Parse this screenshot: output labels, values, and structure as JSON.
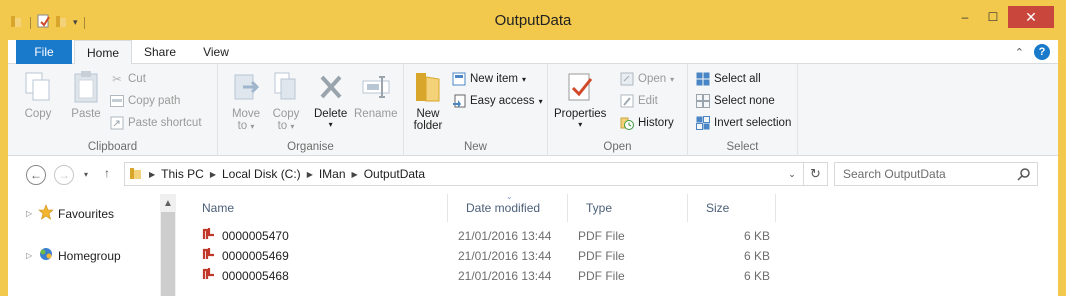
{
  "window": {
    "title": "OutputData",
    "controls": {
      "minimize": "–",
      "maximize": "☐",
      "close": "✕"
    }
  },
  "ribbon": {
    "tabs": [
      "File",
      "Home",
      "Share",
      "View"
    ],
    "active_tab": "Home",
    "groups": {
      "clipboard": {
        "label": "Clipboard",
        "copy": "Copy",
        "paste": "Paste",
        "cut": "Cut",
        "copy_path": "Copy path",
        "paste_shortcut": "Paste shortcut"
      },
      "organise": {
        "label": "Organise",
        "move_to": "Move",
        "move_to_2": "to",
        "copy_to": "Copy",
        "copy_to_2": "to",
        "delete": "Delete",
        "rename": "Rename"
      },
      "new": {
        "label": "New",
        "new_folder": "New",
        "new_folder_2": "folder",
        "new_item": "New item",
        "easy_access": "Easy access"
      },
      "open": {
        "label": "Open",
        "properties": "Properties",
        "open": "Open",
        "edit": "Edit",
        "history": "History"
      },
      "select": {
        "label": "Select",
        "select_all": "Select all",
        "select_none": "Select none",
        "invert_selection": "Invert selection"
      }
    }
  },
  "address": {
    "crumbs": [
      "This PC",
      "Local Disk (C:)",
      "IMan",
      "OutputData"
    ]
  },
  "search": {
    "placeholder": "Search OutputData"
  },
  "nav_pane": {
    "items": [
      "Favourites",
      "Homegroup"
    ]
  },
  "file_list": {
    "columns": [
      "Name",
      "Date modified",
      "Type",
      "Size"
    ],
    "rows": [
      {
        "name": "0000005470",
        "date": "21/01/2016 13:44",
        "type": "PDF File",
        "size": "6 KB"
      },
      {
        "name": "0000005469",
        "date": "21/01/2016 13:44",
        "type": "PDF File",
        "size": "6 KB"
      },
      {
        "name": "0000005468",
        "date": "21/01/2016 13:44",
        "type": "PDF File",
        "size": "6 KB"
      }
    ]
  },
  "colors": {
    "titlebar": "#f2c94c",
    "file_tab": "#1979ca",
    "close_button": "#c9463d",
    "pdf_icon": "#c0392b"
  }
}
